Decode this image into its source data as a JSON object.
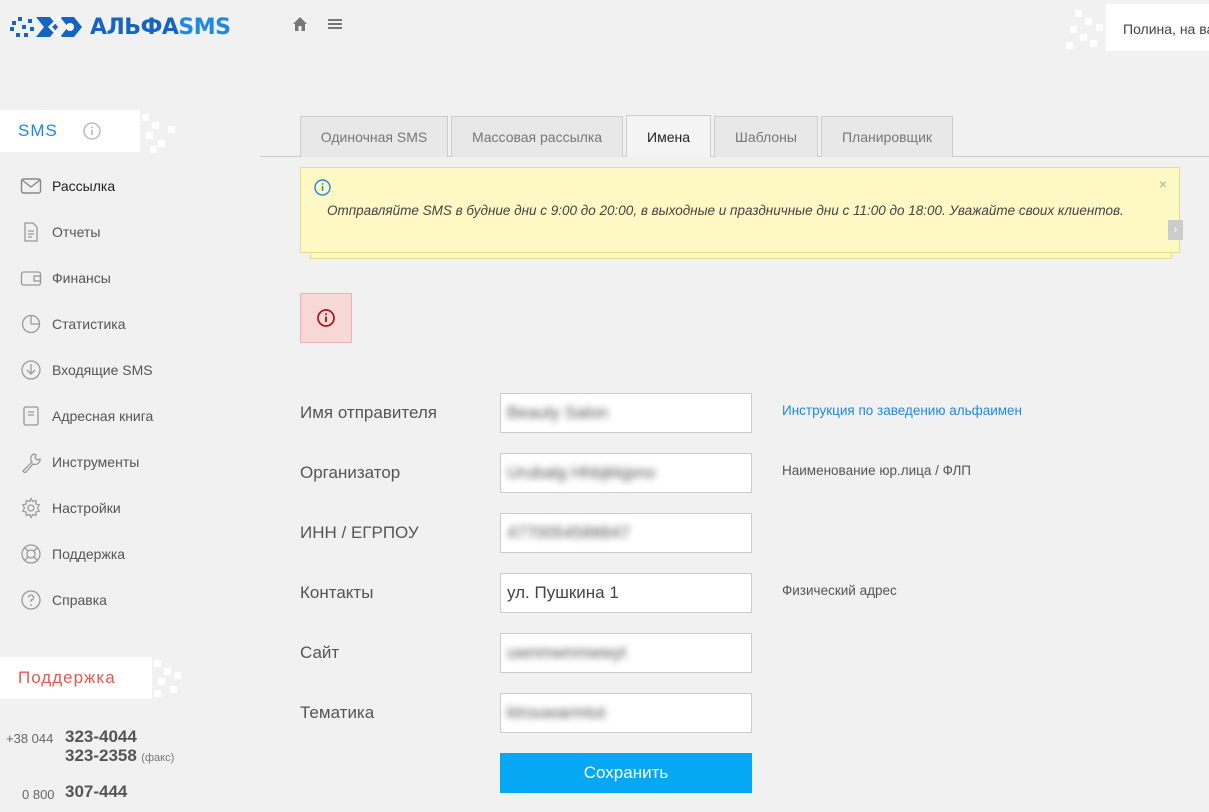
{
  "header": {
    "logo_text_main": "АЛЬФА",
    "logo_text_sms": "SMS",
    "user_greeting": "Полина, на ва",
    "icons": [
      "home-icon",
      "menu-icon"
    ]
  },
  "sidebar": {
    "section_title": "SMS",
    "items": [
      {
        "label": "Рассылка",
        "icon": "envelope-icon"
      },
      {
        "label": "Отчеты",
        "icon": "document-icon"
      },
      {
        "label": "Финансы",
        "icon": "wallet-icon"
      },
      {
        "label": "Статистика",
        "icon": "pie-chart-icon"
      },
      {
        "label": "Входящие SMS",
        "icon": "download-icon"
      },
      {
        "label": "Адресная книга",
        "icon": "address-book-icon"
      },
      {
        "label": "Инструменты",
        "icon": "wrench-icon"
      },
      {
        "label": "Настройки",
        "icon": "gear-icon"
      },
      {
        "label": "Поддержка",
        "icon": "lifebuoy-icon"
      },
      {
        "label": "Справка",
        "icon": "question-icon"
      }
    ],
    "support_title": "Поддержка",
    "phones": {
      "kyiv_code": "+38 044",
      "kyiv_1": "323-4044",
      "kyiv_2": "323-2358",
      "fax_label": "(факс)",
      "free_code": "0 800",
      "free": "307-444"
    }
  },
  "tabs": [
    {
      "label": "Одиночная SMS",
      "active": false
    },
    {
      "label": "Массовая рассылка",
      "active": false
    },
    {
      "label": "Имена",
      "active": true
    },
    {
      "label": "Шаблоны",
      "active": false
    },
    {
      "label": "Планировщик",
      "active": false
    }
  ],
  "notice": {
    "text": "Отправляйте SMS в будние дни с 9:00 до 20:00, в выходные и праздничные дни с 11:00 до 18:00. Уважайте своих клиентов.",
    "close": "×",
    "side_arrow": "›"
  },
  "form": {
    "fields": [
      {
        "label": "Имя отправителя",
        "value": "Beauty Salon",
        "hint": "Инструкция по заведению альфаимен"
      },
      {
        "label": "Организатор",
        "value": "Urubalg Hhbjkkjpno",
        "hint": "Наименование юр.лица / ФЛП"
      },
      {
        "label": "ИНН / ЕГРПОУ",
        "value": "4770054588847",
        "hint": ""
      },
      {
        "label": "Контакты",
        "value": "ул. Пушкина 1",
        "hint": "Физический адрес"
      },
      {
        "label": "Сайт",
        "value": "uwnmwnmwwyt",
        "hint": ""
      },
      {
        "label": "Тематика",
        "value": "ktrouwarmtut",
        "hint": ""
      }
    ],
    "save_label": "Сохранить"
  },
  "colors": {
    "brand_dark": "#1565c0",
    "brand_light": "#1e88e5",
    "save_button": "#07a8f3",
    "notice_bg": "#fdf8c4",
    "error_bg": "#f8d7d7",
    "support_title": "#e8584f"
  }
}
